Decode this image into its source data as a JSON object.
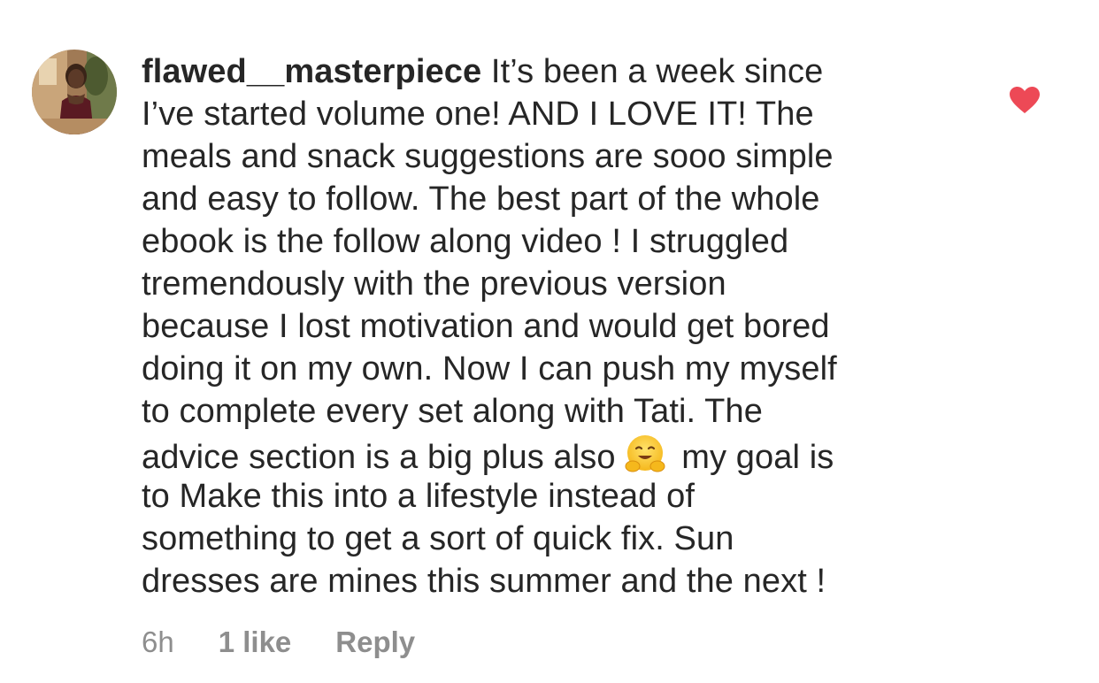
{
  "comment": {
    "username": "flawed__masterpiece",
    "lines": [
      "It’s been a week since",
      "I’ve started volume one! AND I LOVE IT! The",
      "meals and snack suggestions are sooo simple",
      "and easy to follow. The best part of the whole",
      "ebook is the follow along video ! I struggled",
      "tremendously with the previous version",
      "because I lost motivation and would get bored",
      "doing it on my own. Now I can push my myself",
      "to complete every set along with Tati. The",
      "advice section is a big plus also",
      "my goal is",
      "to Make this into a lifestyle instead of",
      "something to get a sort of quick fix. Sun",
      "dresses are mines this summer and the next !"
    ],
    "emoji": "hugging-face-emoji",
    "liked": true
  },
  "meta": {
    "time": "6h",
    "likes": "1 like",
    "reply": "Reply"
  },
  "colors": {
    "text": "#262626",
    "secondary": "#8e8e8e",
    "heart": "#ed4956"
  },
  "icons": {
    "like": "heart-icon",
    "avatar": "profile-avatar"
  }
}
